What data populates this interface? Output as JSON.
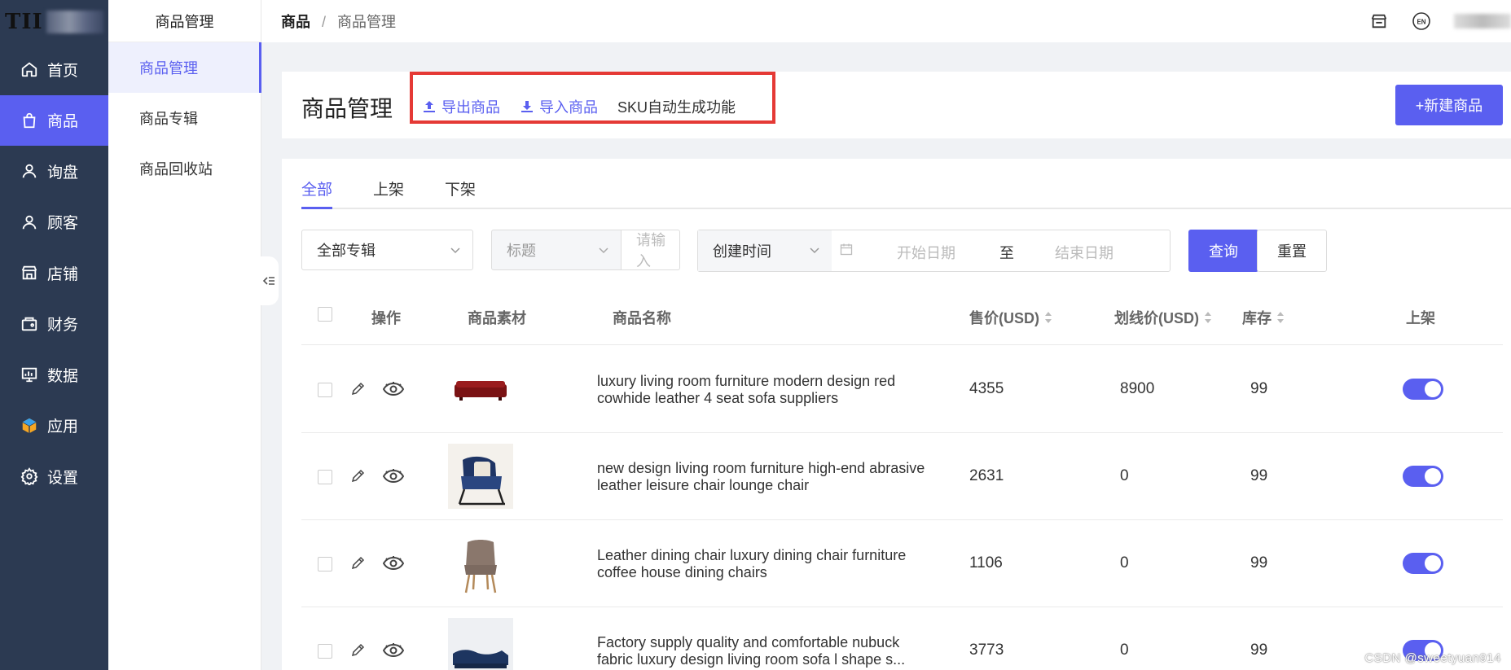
{
  "logo": {
    "text": "TII"
  },
  "nav": {
    "items": [
      {
        "label": "首页",
        "icon": "home-icon"
      },
      {
        "label": "商品",
        "icon": "bag-icon",
        "active": true
      },
      {
        "label": "询盘",
        "icon": "user-icon"
      },
      {
        "label": "顾客",
        "icon": "user-icon"
      },
      {
        "label": "店铺",
        "icon": "store-icon"
      },
      {
        "label": "财务",
        "icon": "wallet-icon"
      },
      {
        "label": "数据",
        "icon": "chart-icon"
      },
      {
        "label": "应用",
        "icon": "cube-icon"
      },
      {
        "label": "设置",
        "icon": "gear-icon"
      }
    ]
  },
  "subnav": {
    "title": "商品管理",
    "items": [
      {
        "label": "商品管理",
        "active": true
      },
      {
        "label": "商品专辑"
      },
      {
        "label": "商品回收站"
      }
    ]
  },
  "breadcrumb": {
    "root": "商品",
    "separator": "/",
    "current": "商品管理"
  },
  "header": {
    "title": "商品管理",
    "export_label": "导出商品",
    "import_label": "导入商品",
    "sku_label": "SKU自动生成功能",
    "new_label": "+新建商品"
  },
  "tabs": [
    {
      "label": "全部",
      "active": true
    },
    {
      "label": "上架"
    },
    {
      "label": "下架"
    }
  ],
  "filters": {
    "album": "全部专辑",
    "field": "标题",
    "keyword_placeholder": "请输入",
    "time_field": "创建时间",
    "start_placeholder": "开始日期",
    "to": "至",
    "end_placeholder": "结束日期",
    "query_label": "查询",
    "reset_label": "重置"
  },
  "table": {
    "headers": {
      "action": "操作",
      "media": "商品素材",
      "name": "商品名称",
      "price": "售价(USD)",
      "strike": "划线价(USD)",
      "stock": "库存",
      "listed": "上架"
    },
    "rows": [
      {
        "name": "luxury living room furniture modern design red cowhide leather 4 seat sofa suppliers",
        "price": "4355",
        "strike": "8900",
        "stock": "99",
        "listed": true,
        "thumb": "red-sofa"
      },
      {
        "name": "new design living room furniture high-end abrasive leather leisure chair lounge chair",
        "price": "2631",
        "strike": "0",
        "stock": "99",
        "listed": true,
        "thumb": "blue-chair"
      },
      {
        "name": "Leather dining chair luxury dining chair furniture coffee house dining chairs",
        "price": "1106",
        "strike": "0",
        "stock": "99",
        "listed": true,
        "thumb": "brown-chair"
      },
      {
        "name": "Factory supply quality and comfortable nubuck fabric luxury design living room sofa l shape s...",
        "price": "3773",
        "strike": "0",
        "stock": "99",
        "listed": true,
        "thumb": "blue-sofa"
      }
    ]
  },
  "watermark": "CSDN @sweetyuan914",
  "colors": {
    "accent": "#5a5ff0",
    "sidebar": "#2c3a52",
    "highlight": "#e53935"
  }
}
